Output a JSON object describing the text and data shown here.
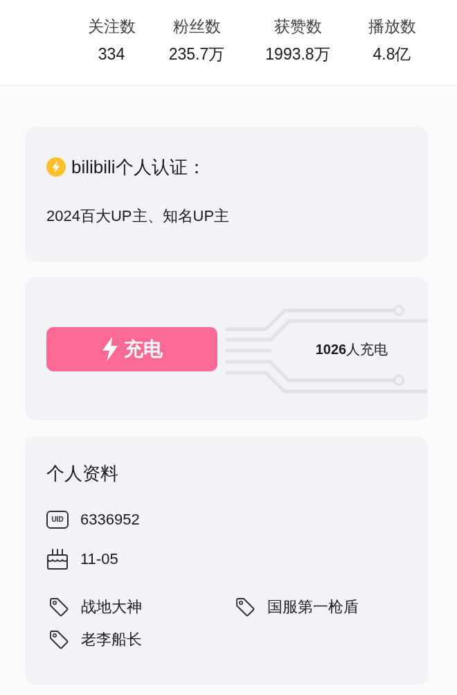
{
  "stats": [
    {
      "label": "关注数",
      "value": "334"
    },
    {
      "label": "粉丝数",
      "value": "235.7万"
    },
    {
      "label": "获赞数",
      "value": "1993.8万"
    },
    {
      "label": "播放数",
      "value": "4.8亿"
    }
  ],
  "verification": {
    "title": "bilibili个人认证：",
    "description": "2024百大UP主、知名UP主"
  },
  "charge": {
    "button": "充电",
    "supporters": "**1026**人充电"
  },
  "profile": {
    "title": "个人资料",
    "fields": [
      {
        "kind": "uid",
        "badge": "UID",
        "value": "6336952"
      },
      {
        "kind": "birthday",
        "value": "11-05"
      }
    ],
    "tags": [
      "战地大神",
      "国服第一枪盾",
      "老李船长"
    ]
  }
}
